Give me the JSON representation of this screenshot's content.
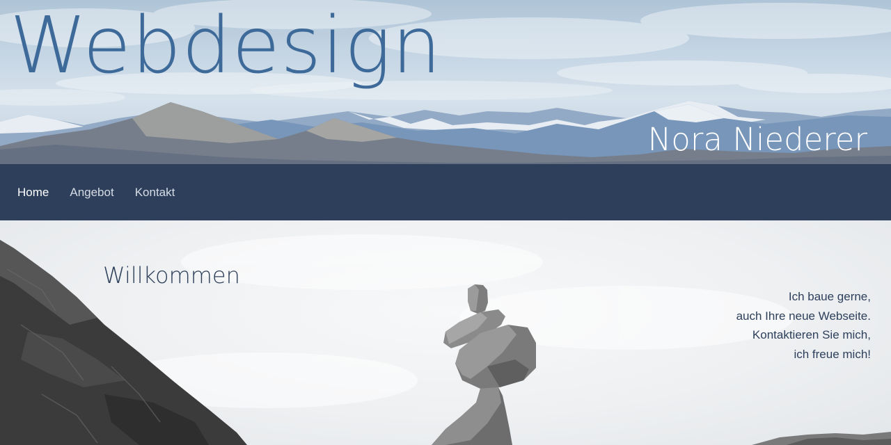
{
  "header": {
    "title": "Webdesign",
    "owner": "Nora Niederer",
    "background": "mountain-panorama"
  },
  "nav": {
    "items": [
      {
        "label": "Home",
        "active": true
      },
      {
        "label": "Angebot",
        "active": false
      },
      {
        "label": "Kontakt",
        "active": false
      }
    ]
  },
  "main": {
    "heading": "Willkommen",
    "intro_lines": [
      "Ich baue gerne,",
      "auch Ihre neue Webseite.",
      "Kontaktieren Sie mich,",
      "ich freue mich!"
    ],
    "background": "stacked-stones-photo"
  },
  "colors": {
    "title": "#3e6a9a",
    "nav_background": "#2d3f5a",
    "nav_text": "#d7dde6",
    "text_dark": "#2d3f5a"
  }
}
